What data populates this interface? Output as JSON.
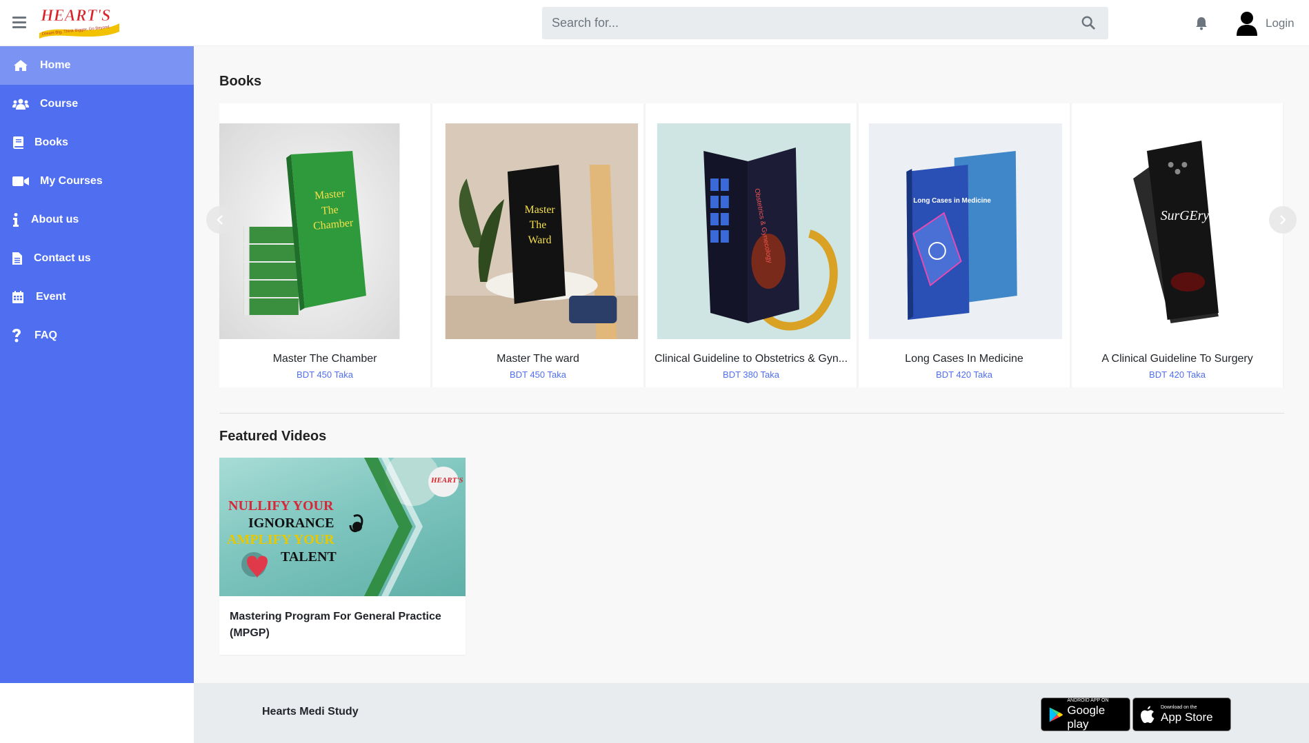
{
  "header": {
    "logo_text": "HEART'S",
    "logo_tagline": "Dream Big, Think Bigger, Go Beyond",
    "search_placeholder": "Search for...",
    "login_label": "Login"
  },
  "sidebar": {
    "items": [
      {
        "label": "Home",
        "icon": "home-icon",
        "active": true
      },
      {
        "label": "Course",
        "icon": "users-icon"
      },
      {
        "label": "Books",
        "icon": "book-icon"
      },
      {
        "label": "My Courses",
        "icon": "video-icon"
      },
      {
        "label": "About us",
        "icon": "info-icon"
      },
      {
        "label": "Contact us",
        "icon": "file-icon"
      },
      {
        "label": "Event",
        "icon": "calendar-icon"
      },
      {
        "label": "FAQ",
        "icon": "question-icon"
      }
    ]
  },
  "books": {
    "title": "Books",
    "items": [
      {
        "title": "Master The Chamber",
        "price": "BDT 450 Taka",
        "cover_color": "#2e9a3c",
        "cover_text": "Master The Chamber"
      },
      {
        "title": "Master The ward",
        "price": "BDT 450 Taka",
        "cover_color": "#111111",
        "cover_text": "Master The Ward"
      },
      {
        "title": "Clinical Guideline to Obstetrics & Gyn...",
        "price": "BDT 380 Taka",
        "cover_color": "#1a1a2e",
        "cover_text": "Obstetrics & Gynecology"
      },
      {
        "title": "Long Cases In Medicine",
        "price": "BDT 420 Taka",
        "cover_color": "#2a4fb5",
        "cover_text": "Long Cases in Medicine"
      },
      {
        "title": "A Clinical Guideline To Surgery",
        "price": "BDT 420 Taka",
        "cover_color": "#141414",
        "cover_text": "SurGEry"
      }
    ]
  },
  "videos": {
    "title": "Featured Videos",
    "items": [
      {
        "title": "Mastering Program For General Practice (MPGP)",
        "thumb_lines": [
          "NULLIFY YOUR",
          "IGNORANCE",
          "AMPLIFY YOUR",
          "TALENT"
        ],
        "thumb_brand": "HEART'S"
      }
    ]
  },
  "footer": {
    "title": "Hearts Medi Study",
    "google_small": "ANDROID APP ON",
    "google_big": "Google play",
    "apple_small": "Download on the",
    "apple_big": "App Store"
  },
  "colors": {
    "accent": "#4f6ef0",
    "sidebar_active": "#7b93f3"
  }
}
